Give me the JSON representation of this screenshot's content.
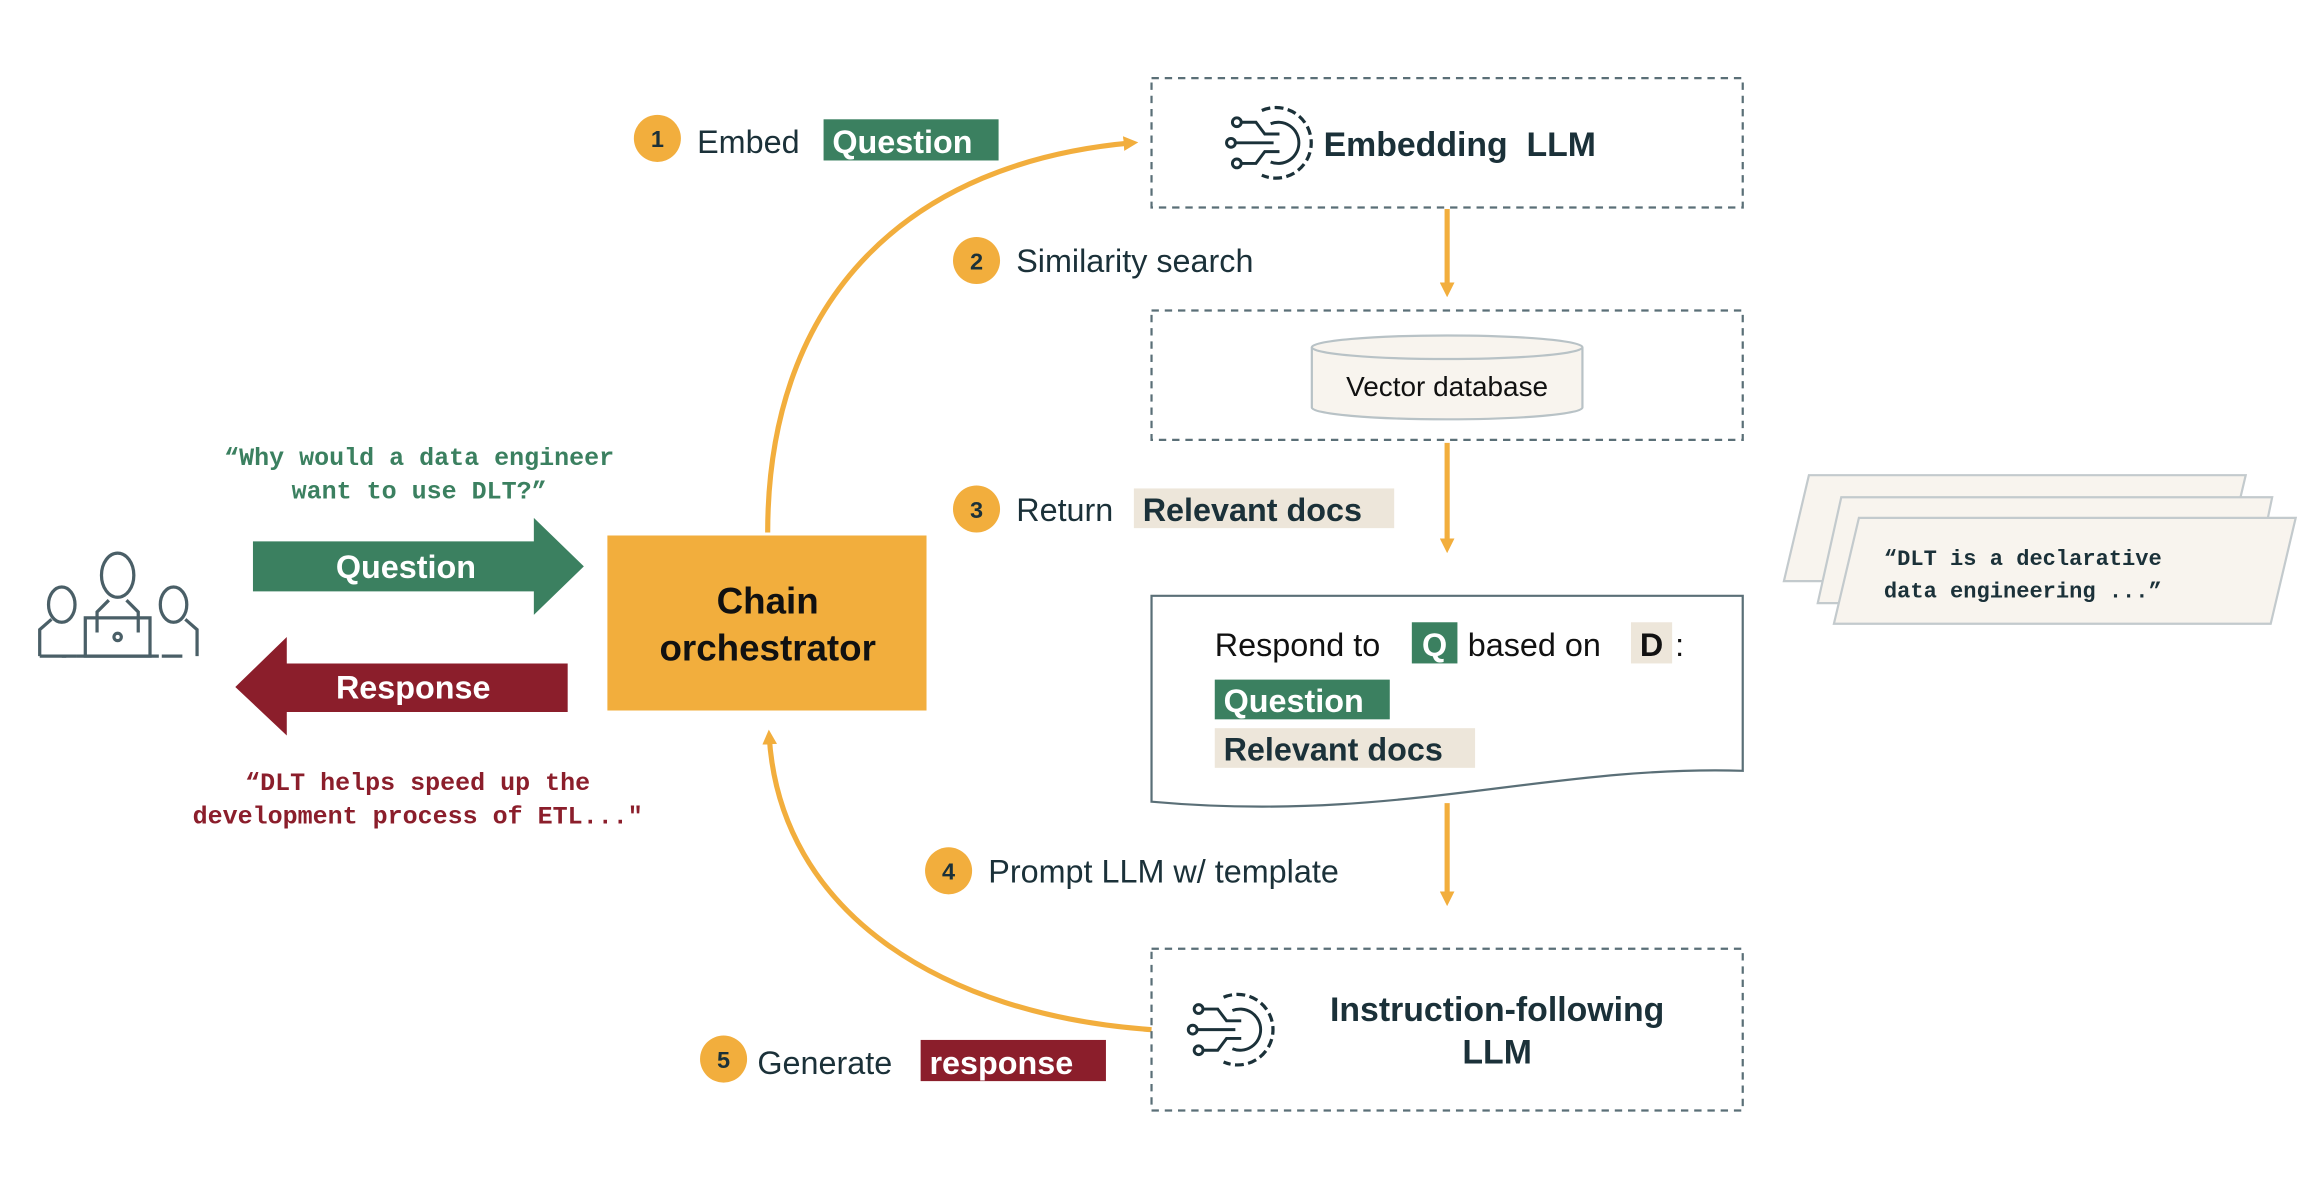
{
  "colors": {
    "green": "#3B8060",
    "red": "#8B1E2B",
    "orange": "#F2AE3D",
    "dark": "#1B3139",
    "gray": "#5A6F77",
    "beige": "#EDE6DA",
    "paper": "#F8F4EE"
  },
  "user": {
    "icon": "users-laptop-icon",
    "question_quote_1": "“Why would a data engineer",
    "question_quote_2": "want to use DLT?”",
    "question_arrow": "Question",
    "response_arrow": "Response",
    "response_quote_1": "“DLT helps speed up the",
    "response_quote_2": "development process of ETL...\""
  },
  "orchestrator": {
    "line1": "Chain",
    "line2": "orchestrator"
  },
  "steps": [
    {
      "num": "1",
      "text": "Embed",
      "tag": "Question"
    },
    {
      "num": "2",
      "text": "Similarity search"
    },
    {
      "num": "3",
      "text": "Return",
      "tag": "Relevant docs"
    },
    {
      "num": "4",
      "text": "Prompt LLM w/ template"
    },
    {
      "num": "5",
      "text": "Generate",
      "tag": "response"
    }
  ],
  "embedding": {
    "label": "Embedding  LLM",
    "icon": "ai-gear-icon"
  },
  "vector_db": {
    "label": "Vector database"
  },
  "template": {
    "respond": "Respond to",
    "q": "Q",
    "based": "based on",
    "d": "D",
    ":": ":",
    "colon": ":",
    "question": "Question",
    "docs": "Relevant docs"
  },
  "docs": {
    "line1": "“DLT is a declarative",
    "line2": "data engineering ...”"
  },
  "instruction": {
    "line1": "Instruction-following",
    "line2": "LLM",
    "icon": "ai-gear-icon"
  }
}
